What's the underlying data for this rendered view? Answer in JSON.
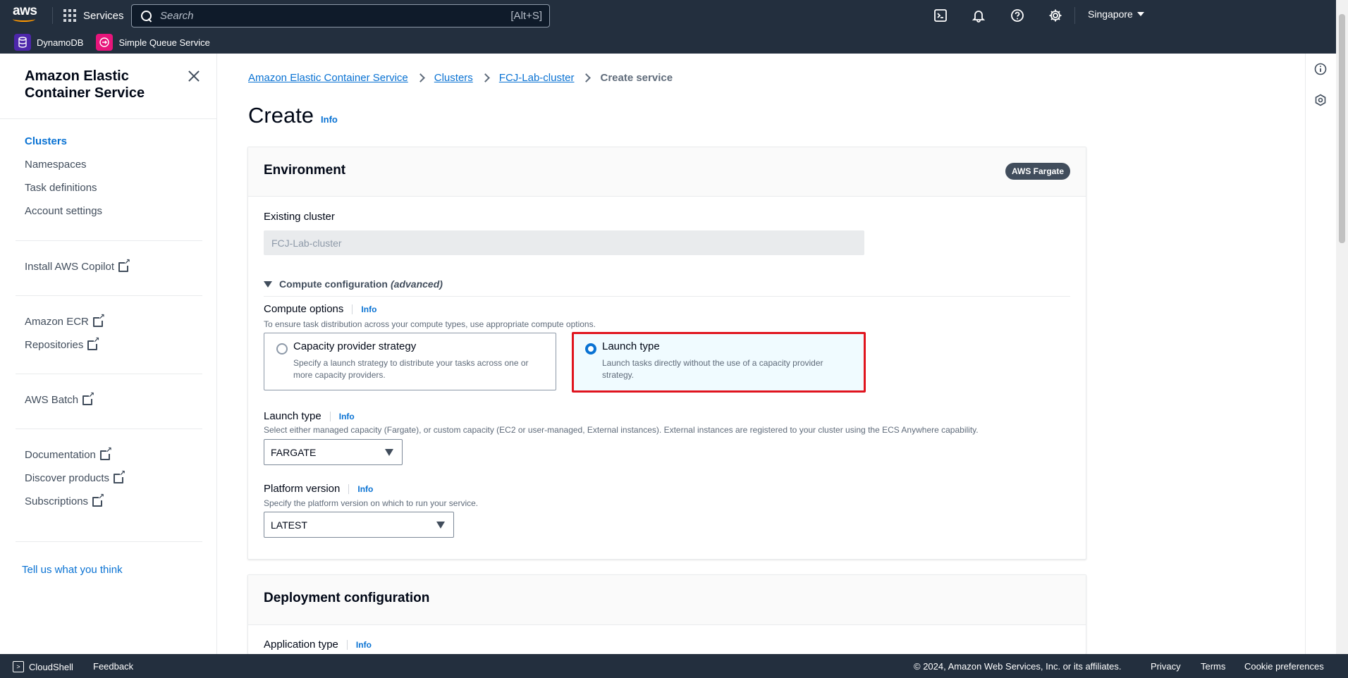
{
  "topbar": {
    "logo_text": "aws",
    "services_label": "Services",
    "search_placeholder": "Search",
    "search_shortcut": "[Alt+S]",
    "region": "Singapore"
  },
  "favorites": [
    {
      "label": "DynamoDB",
      "color": "#4d27aa"
    },
    {
      "label": "Simple Queue Service",
      "color": "#e7157b"
    }
  ],
  "sidebar": {
    "title": "Amazon Elastic Container Service",
    "groups": [
      [
        "Clusters",
        "Namespaces",
        "Task definitions",
        "Account settings"
      ],
      [
        "Install AWS Copilot"
      ],
      [
        "Amazon ECR",
        "Repositories"
      ],
      [
        "AWS Batch"
      ],
      [
        "Documentation",
        "Discover products",
        "Subscriptions"
      ]
    ],
    "items": {
      "clusters": "Clusters",
      "namespaces": "Namespaces",
      "task_definitions": "Task definitions",
      "account_settings": "Account settings",
      "install_copilot": "Install AWS Copilot",
      "amazon_ecr": "Amazon ECR",
      "repositories": "Repositories",
      "aws_batch": "AWS Batch",
      "documentation": "Documentation",
      "discover_products": "Discover products",
      "subscriptions": "Subscriptions"
    },
    "feedback": "Tell us what you think"
  },
  "breadcrumbs": {
    "ecs": "Amazon Elastic Container Service",
    "clusters": "Clusters",
    "cluster": "FCJ-Lab-cluster",
    "current": "Create service"
  },
  "page": {
    "title": "Create",
    "info": "Info"
  },
  "environment": {
    "title": "Environment",
    "badge": "AWS Fargate",
    "existing_cluster_label": "Existing cluster",
    "existing_cluster_value": "FCJ-Lab-cluster",
    "compute_config_label": "Compute configuration",
    "compute_config_suffix": "(advanced)",
    "compute_options_label": "Compute options",
    "compute_options_desc": "To ensure task distribution across your compute types, use appropriate compute options.",
    "option_capacity_title": "Capacity provider strategy",
    "option_capacity_desc": "Specify a launch strategy to distribute your tasks across one or more capacity providers.",
    "option_launch_title": "Launch type",
    "option_launch_desc": "Launch tasks directly without the use of a capacity provider strategy.",
    "launch_type_label": "Launch type",
    "launch_type_desc": "Select either managed capacity (Fargate), or custom capacity (EC2 or user-managed, External instances). External instances are registered to your cluster using the ECS Anywhere capability.",
    "launch_type_value": "FARGATE",
    "platform_label": "Platform version",
    "platform_desc": "Specify the platform version on which to run your service.",
    "platform_value": "LATEST",
    "info": "Info"
  },
  "deployment": {
    "title": "Deployment configuration",
    "application_type_label": "Application type",
    "info": "Info"
  },
  "footer": {
    "cloudshell": "CloudShell",
    "feedback": "Feedback",
    "copyright": "© 2024, Amazon Web Services, Inc. or its affiliates.",
    "privacy": "Privacy",
    "terms": "Terms",
    "cookie": "Cookie preferences"
  }
}
